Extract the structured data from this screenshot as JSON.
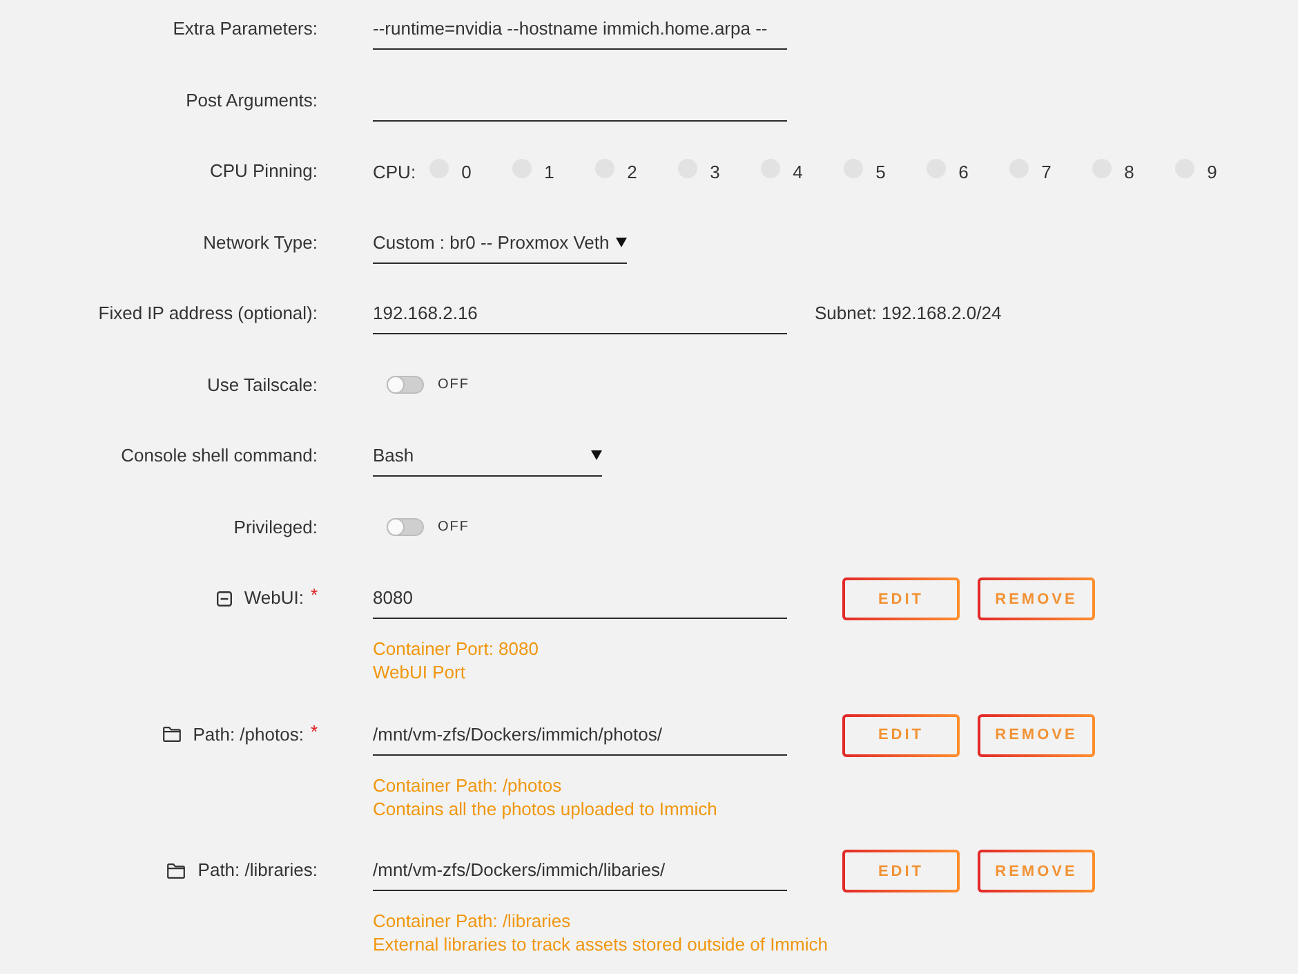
{
  "settings": [
    {
      "kind": "text",
      "label": "Extra Parameters:",
      "value": "--runtime=nvidia --hostname immich.home.arpa --"
    },
    {
      "kind": "text",
      "label": "Post Arguments:"
    },
    {
      "kind": "cpu",
      "label": "CPU Pinning:",
      "prefix": "CPU:",
      "cpus": [
        {
          "label": "0",
          "checked": false
        },
        {
          "label": "1",
          "checked": false
        },
        {
          "label": "2",
          "checked": false
        },
        {
          "label": "3",
          "checked": false
        },
        {
          "label": "4",
          "checked": false
        },
        {
          "label": "5",
          "checked": false
        },
        {
          "label": "6",
          "checked": false
        },
        {
          "label": "7",
          "checked": false
        },
        {
          "label": "8",
          "checked": false
        },
        {
          "label": "9",
          "checked": false
        }
      ]
    },
    {
      "kind": "select",
      "label": "Network Type:",
      "value": "Custom : br0 -- Proxmox Veth"
    },
    {
      "kind": "text",
      "label": "Fixed IP address (optional):",
      "value": "192.168.2.16",
      "note": "Subnet: 192.168.2.0/24"
    },
    {
      "kind": "toggle",
      "label": "Use Tailscale:",
      "on": false,
      "state_text": "OFF"
    },
    {
      "kind": "select",
      "label": "Console shell command:",
      "value": "Bash"
    },
    {
      "kind": "toggle",
      "label": "Privileged:",
      "on": false,
      "state_text": "OFF"
    }
  ],
  "config_items": [
    {
      "kind": "port",
      "label": "WebUI:",
      "required_mark": "*",
      "value": "8080",
      "buttons": [
        "EDIT",
        "REMOVE"
      ],
      "details": [
        "Container Port: 8080",
        "WebUI Port"
      ]
    },
    {
      "kind": "path",
      "label": "Path: /photos:",
      "required_mark": "*",
      "value": "/mnt/vm-zfs/Dockers/immich/photos/",
      "buttons": [
        "EDIT",
        "REMOVE"
      ],
      "details": [
        "Container Path: /photos",
        "Contains all the photos uploaded to Immich"
      ]
    },
    {
      "kind": "path",
      "label": "Path: /libraries:",
      "value": "/mnt/vm-zfs/Dockers/immich/libaries/",
      "buttons": [
        "EDIT",
        "REMOVE"
      ],
      "details": [
        "Container Path: /libraries",
        "External libraries to track assets stored outside of Immich"
      ]
    }
  ]
}
